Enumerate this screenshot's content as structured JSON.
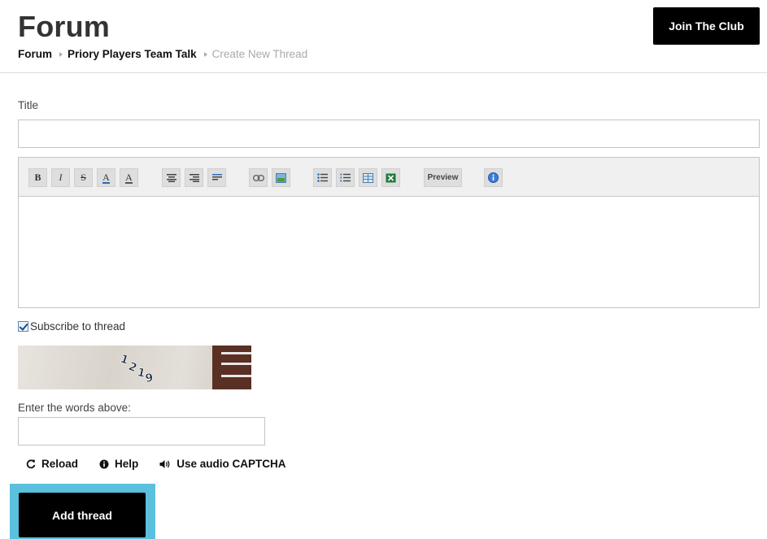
{
  "header": {
    "title": "Forum",
    "breadcrumb": [
      "Forum",
      "Priory Players Team Talk",
      "Create New Thread"
    ],
    "join_button": "Join The Club"
  },
  "form": {
    "title_label": "Title",
    "title_value": "",
    "toolbar": {
      "buttons": [
        "bold",
        "italic",
        "strikethrough",
        "font-color",
        "highlight",
        "align-center",
        "align-right",
        "align-justify",
        "link",
        "image",
        "unordered-list",
        "ordered-list",
        "table",
        "excel"
      ],
      "bold_glyph": "B",
      "italic_glyph": "I",
      "strike_glyph": "S",
      "font_color_glyph": "A",
      "highlight_glyph": "A",
      "preview_label": "Preview"
    },
    "body_value": "",
    "subscribe_label": "Subscribe to thread",
    "subscribe_checked": true,
    "captcha_text": "1219",
    "captcha_label": "Enter the words above:",
    "captcha_value": "",
    "links": {
      "reload": "Reload",
      "help": "Help",
      "audio": "Use audio CAPTCHA"
    },
    "submit_label": "Add thread"
  },
  "colors": {
    "primary": "#000000",
    "highlight_frame": "#5bc0de",
    "border": "#c4c4c4"
  }
}
